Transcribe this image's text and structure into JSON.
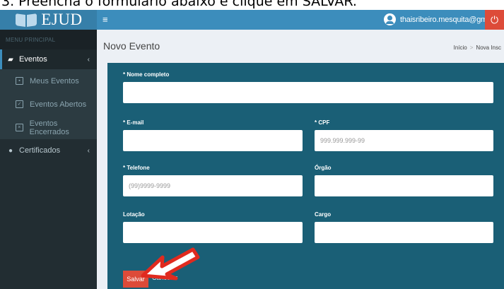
{
  "caption": "3. Preencha o formulário abaixo e clique em SALVAR.",
  "brand": {
    "logo_text": "EJUD"
  },
  "header": {
    "menu_toggle": "≡",
    "user_email": "thaisribeiro.mesquita@gmail.com",
    "power_icon": "⏻"
  },
  "sidebar": {
    "section_title": "MENU PRINCIPAL",
    "items": [
      {
        "label": "Eventos",
        "icon": "book-icon"
      },
      {
        "label": "Meus Eventos",
        "icon": "user-square-icon"
      },
      {
        "label": "Eventos Abertos",
        "icon": "calendar-check-icon"
      },
      {
        "label": "Eventos Encerrados",
        "icon": "calendar-x-icon"
      },
      {
        "label": "Certificados",
        "icon": "certificate-icon"
      }
    ]
  },
  "page": {
    "title": "Novo Evento",
    "breadcrumb": [
      "Início",
      "Nova Insc"
    ]
  },
  "form": {
    "nome_label": "* Nome completo",
    "email_label": "* E-mail",
    "cpf_label": "* CPF",
    "cpf_placeholder": "999.999.999-99",
    "telefone_label": "* Telefone",
    "telefone_placeholder": "(99)9999-9999",
    "orgao_label": "Órgão",
    "lotacao_label": "Lotação",
    "cargo_label": "Cargo",
    "save_label": "Salvar",
    "cancel_label": "Cancelar"
  },
  "colors": {
    "header": "#3c8dbc",
    "logo_bg": "#367fa9",
    "sidebar": "#222d32",
    "panel": "#1a5f76",
    "danger": "#dd4b39",
    "arrow": "#e02a1f"
  }
}
